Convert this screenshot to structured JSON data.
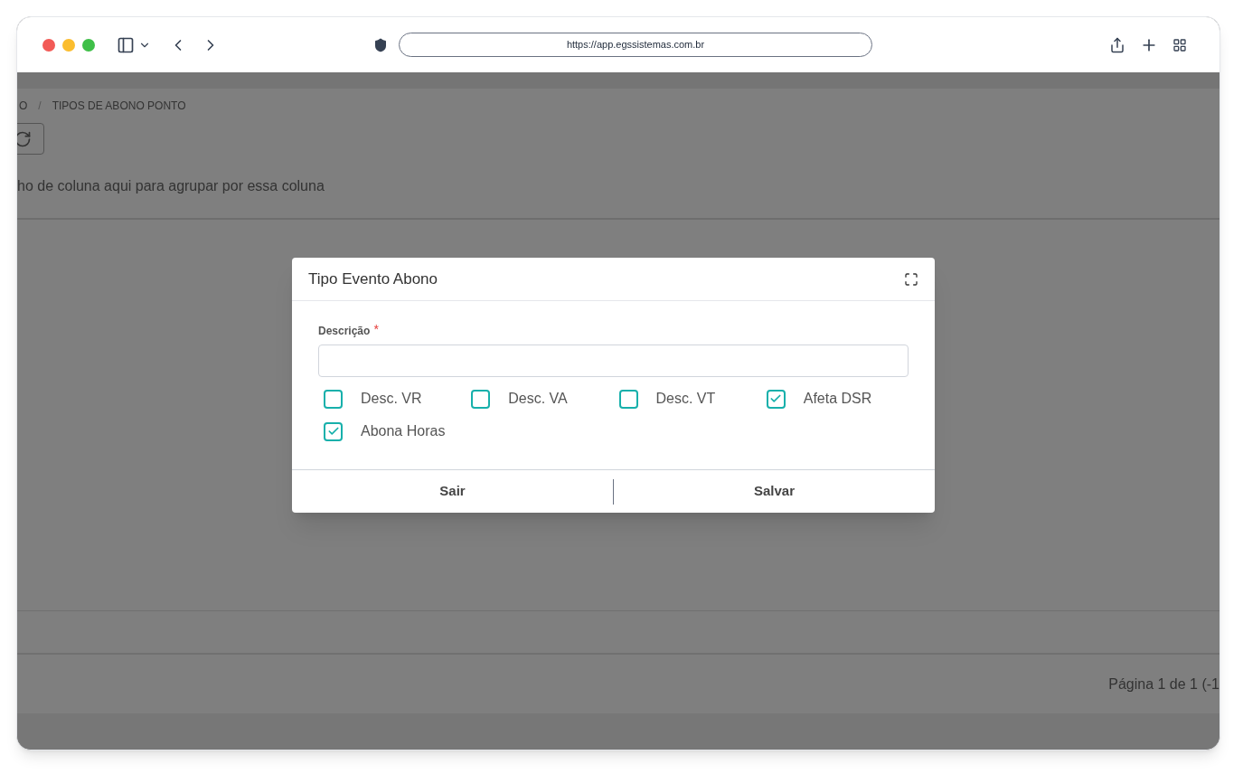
{
  "browser": {
    "url": "https://app.egssistemas.com.br"
  },
  "breadcrumb": [
    "O",
    "TIPOS DE ABONO PONTO"
  ],
  "breadcrumb_separator": "/",
  "group_hint": "ho de coluna aqui para agrupar por essa coluna",
  "pager": "Página 1 de 1 (-1",
  "dialog": {
    "title": "Tipo Evento Abono",
    "field": {
      "label": "Descrição",
      "required_mark": "*"
    },
    "options": [
      {
        "label": "Desc. VR",
        "checked": false
      },
      {
        "label": "Desc. VA",
        "checked": false
      },
      {
        "label": "Desc. VT",
        "checked": false
      },
      {
        "label": "Afeta DSR",
        "checked": true
      },
      {
        "label": "Abona Horas",
        "checked": true
      }
    ],
    "buttons": [
      "Sair",
      "Salvar"
    ]
  }
}
